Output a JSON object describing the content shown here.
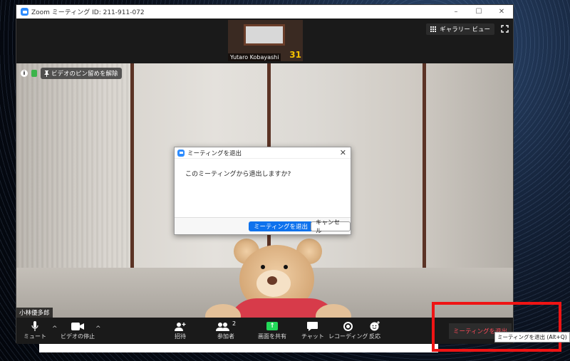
{
  "window": {
    "title": "Zoom ミーティング ID: 211-911-072",
    "minimize": "–",
    "maximize": "☐",
    "close": "✕"
  },
  "top": {
    "gallery_label": "ギャラリー ビュー",
    "thumbnail_name": "Yutaro Kobayashi",
    "thumbnail_number": "31"
  },
  "video": {
    "info_icon": "i",
    "unpin_label": "ビデオのピン留めを解除",
    "participant_name": "小林優多郎"
  },
  "dialog": {
    "title": "ミーティングを退出",
    "close": "✕",
    "message": "このミーティングから退出しますか?",
    "leave_label": "ミーティングを退出",
    "cancel_label": "キャンセル"
  },
  "toolbar": {
    "mute_label": "ミュート",
    "video_label": "ビデオの停止",
    "invite_label": "招待",
    "participants_label": "参加者",
    "participants_count": "2",
    "share_label": "画面を共有",
    "chat_label": "チャット",
    "record_label": "レコーディング",
    "reactions_label": "反応",
    "leave_label": "ミーティングを退出",
    "caret": "^"
  },
  "tooltip": {
    "text": "ミーティングを退出 (Alt+Q)"
  },
  "colors": {
    "zoom_blue": "#2d8cff",
    "leave_red": "#ff4b59",
    "highlight_red": "#ef1414",
    "share_green": "#23d959"
  }
}
